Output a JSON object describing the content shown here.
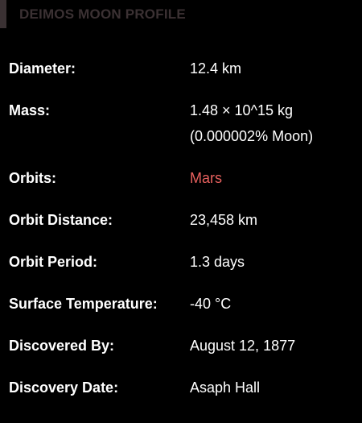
{
  "header": {
    "title": "DEIMOS MOON PROFILE"
  },
  "colors": {
    "background": "#000000",
    "header_text": "#3b3133",
    "header_bar": "#3a3133",
    "text": "#ffffff",
    "link": "#e8615e"
  },
  "profile": {
    "rows": [
      {
        "label": "Diameter:",
        "value_lines": [
          "12.4 km"
        ]
      },
      {
        "label": "Mass:",
        "value_lines": [
          "1.48 × 10^15 kg",
          "(0.000002% Moon)"
        ]
      },
      {
        "label": "Orbits:",
        "value_lines": [
          "Mars"
        ]
      },
      {
        "label": "Orbit Distance:",
        "value_lines": [
          "23,458 km"
        ]
      },
      {
        "label": "Orbit Period:",
        "value_lines": [
          "1.3 days"
        ]
      },
      {
        "label": "Surface Temperature:",
        "value_lines": [
          "-40 °C"
        ]
      },
      {
        "label": "Discovered By:",
        "value_lines": [
          "August 12, 1877"
        ]
      },
      {
        "label": "Discovery Date:",
        "value_lines": [
          "Asaph Hall"
        ]
      }
    ]
  }
}
